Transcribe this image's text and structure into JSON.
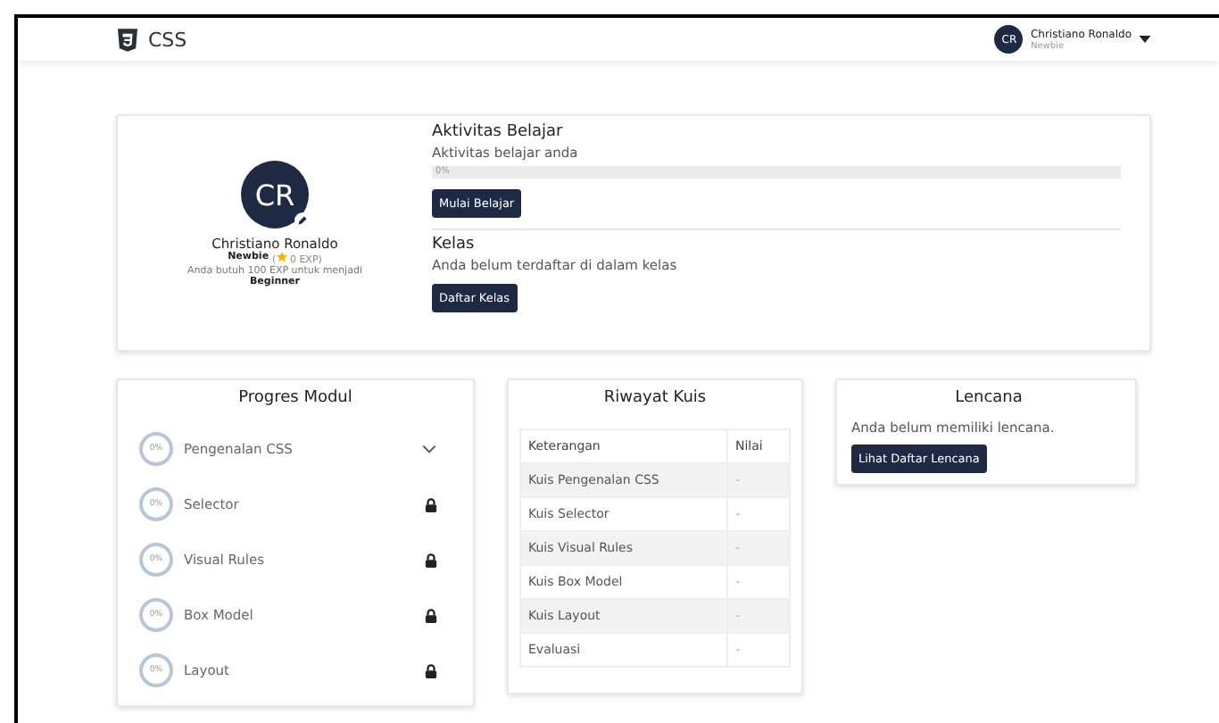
{
  "nav": {
    "brand": "CSS",
    "user": {
      "initials": "CR",
      "name": "Christiano Ronaldo",
      "level": "Newbie"
    }
  },
  "profile": {
    "initials": "CR",
    "name": "Christiano Ronaldo",
    "rank": "Newbie",
    "exp_open": "(",
    "exp": "0 EXP)",
    "hint": "Anda butuh 100 EXP untuk menjadi",
    "next": "Beginner"
  },
  "activity": {
    "title": "Aktivitas Belajar",
    "subtitle": "Aktivitas belajar anda",
    "progress_label": "0%",
    "level": 0,
    "button": "Mulai Belajar"
  },
  "class": {
    "title": "Kelas",
    "text": "Anda belum terdaftar di dalam kelas",
    "button": "Daftar Kelas"
  },
  "modules": {
    "title": "Progres Modul",
    "items": [
      {
        "progress": "0%",
        "name": "Pengenalan CSS",
        "kind": "expand"
      },
      {
        "progress": "0%",
        "name": "Selector",
        "kind": "locked"
      },
      {
        "progress": "0%",
        "name": "Visual Rules",
        "kind": "locked"
      },
      {
        "progress": "0%",
        "name": "Box Model",
        "kind": "locked"
      },
      {
        "progress": "0%",
        "name": "Layout",
        "kind": "locked"
      }
    ]
  },
  "quiz": {
    "title": "Riwayat Kuis",
    "columns": [
      "Keterangan",
      "Nilai"
    ],
    "rows": [
      [
        "Kuis Pengenalan CSS",
        "-"
      ],
      [
        "Kuis Selector",
        "-"
      ],
      [
        "Kuis Visual Rules",
        "-"
      ],
      [
        "Kuis Box Model",
        "-"
      ],
      [
        "Kuis Layout",
        "-"
      ],
      [
        "Evaluasi",
        "-"
      ]
    ]
  },
  "badges": {
    "title": "Lencana",
    "text": "Anda belum memiliki lencana.",
    "button": "Lihat Daftar Lencana"
  }
}
